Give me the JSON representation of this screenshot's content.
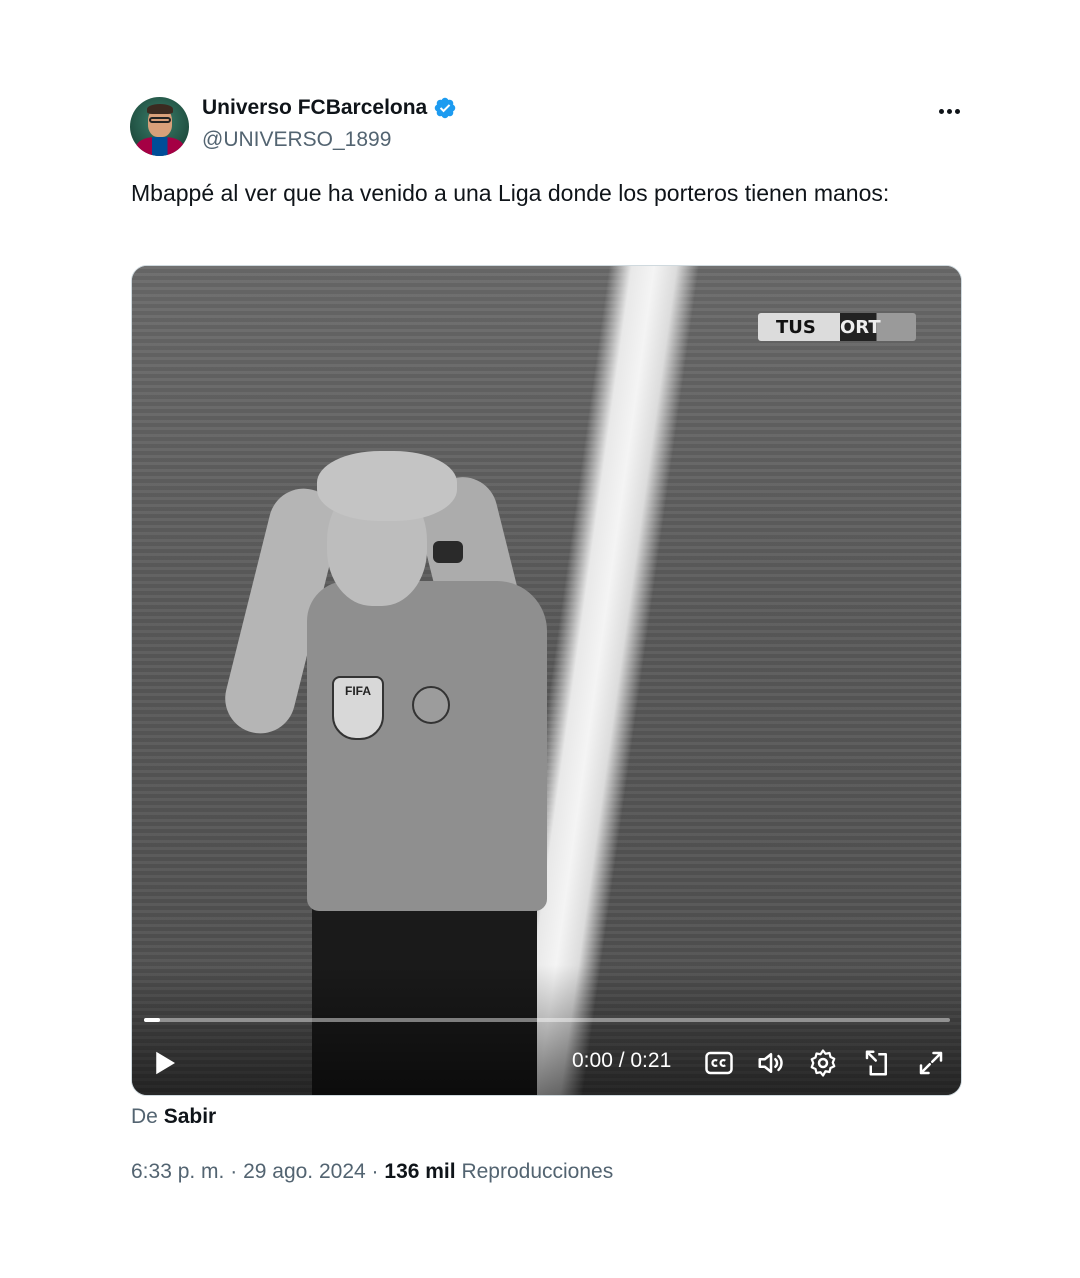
{
  "author": {
    "display_name": "Universo FCBarcelona",
    "handle": "@UNIVERSO_1899",
    "verified": true
  },
  "tweet": {
    "text": "Mbappé al ver que ha venido a una Liga donde los porteros tienen manos:"
  },
  "video": {
    "overlay_logo_left": "TUS",
    "overlay_logo_right": "ORT",
    "badge_text": "FIFA",
    "time": "0:00 / 0:21",
    "progress_fraction": 0.01,
    "icons": [
      "play-icon",
      "captions-icon",
      "volume-icon",
      "settings-icon",
      "picture-in-picture-icon",
      "fullscreen-icon"
    ]
  },
  "source": {
    "prefix": "De",
    "name": "Sabir"
  },
  "meta": {
    "time": "6:33 p. m.",
    "separator": "·",
    "date": "29 ago. 2024",
    "views_count": "136 mil",
    "views_label": "Reproducciones"
  },
  "colors": {
    "text_primary": "#0f1419",
    "text_secondary": "#536471",
    "verified_blue": "#1d9bf0"
  }
}
